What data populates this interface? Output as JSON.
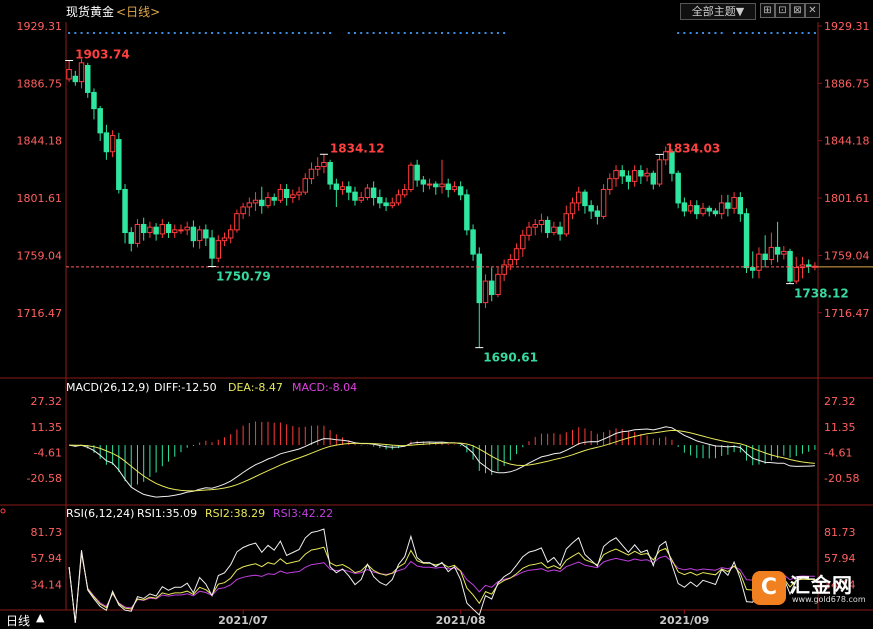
{
  "header": {
    "instrument": "现货黄金",
    "period_tag": "<日线>",
    "theme_button": "全部主题▼",
    "icons": [
      "grid-icon",
      "zoom-in-icon",
      "zoom-out-icon",
      "close-icon"
    ],
    "icon_glyphs": [
      "⊞",
      "⊡",
      "⊠",
      "✕"
    ]
  },
  "footer": {
    "timeframe": "日线",
    "timeframe_arrow": "▲"
  },
  "watermark": {
    "text": "汇金网",
    "url": "www.gold678.com",
    "mark": "C"
  },
  "chart_data": {
    "type": "candlestick",
    "colors": {
      "up": "#ff3b3b",
      "down": "#2ee6a0",
      "diff": "#f0f0f0",
      "dea": "#e8e85a",
      "macd": "#e040e0",
      "rsi1": "#f0f0f0",
      "rsi2": "#e8e85a",
      "rsi3": "#c040e0",
      "axis_label": "#ff6060",
      "dots": "#3a8ee6",
      "last_price_line": "#ff6060"
    },
    "main": {
      "y_ticks": [
        "1929.31",
        "1886.75",
        "1844.18",
        "1801.61",
        "1759.04",
        "1716.47"
      ],
      "ylim": [
        1674,
        1929.31
      ],
      "last_price": 1750.5,
      "annotations": [
        {
          "index": 0,
          "label": "1903.74",
          "type": "high"
        },
        {
          "index": 23,
          "label": "1750.79",
          "type": "low"
        },
        {
          "index": 41,
          "label": "1834.12",
          "type": "high"
        },
        {
          "index": 66,
          "label": "1690.61",
          "type": "low"
        },
        {
          "index": 95,
          "label": "1834.03",
          "type": "high"
        },
        {
          "index": 116,
          "label": "1738.12",
          "type": "low"
        }
      ],
      "candles": [
        [
          1890,
          1897,
          1888,
          1903.7
        ],
        [
          1892,
          1888,
          1885,
          1896
        ],
        [
          1888,
          1902,
          1883,
          1905
        ],
        [
          1900,
          1880,
          1876,
          1902
        ],
        [
          1880,
          1868,
          1860,
          1883
        ],
        [
          1868,
          1850,
          1844,
          1870
        ],
        [
          1850,
          1836,
          1830,
          1856
        ],
        [
          1836,
          1848,
          1832,
          1852
        ],
        [
          1845,
          1808,
          1805,
          1850
        ],
        [
          1808,
          1776,
          1768,
          1812
        ],
        [
          1776,
          1768,
          1762,
          1780
        ],
        [
          1768,
          1782,
          1765,
          1786
        ],
        [
          1782,
          1776,
          1770,
          1787
        ],
        [
          1776,
          1780,
          1772,
          1784
        ],
        [
          1780,
          1775,
          1770,
          1783
        ],
        [
          1775,
          1782,
          1772,
          1786
        ],
        [
          1782,
          1776,
          1772,
          1784
        ],
        [
          1776,
          1778,
          1772,
          1782
        ],
        [
          1778,
          1778,
          1775,
          1782
        ],
        [
          1778,
          1780,
          1774,
          1784
        ],
        [
          1780,
          1770,
          1765,
          1785
        ],
        [
          1770,
          1778,
          1764,
          1781
        ],
        [
          1778,
          1772,
          1766,
          1782
        ],
        [
          1772,
          1757,
          1750.8,
          1778
        ],
        [
          1757,
          1770,
          1754,
          1774
        ],
        [
          1770,
          1772,
          1766,
          1776
        ],
        [
          1772,
          1778,
          1768,
          1782
        ],
        [
          1778,
          1790,
          1776,
          1793
        ],
        [
          1790,
          1795,
          1786,
          1798
        ],
        [
          1795,
          1798,
          1788,
          1802
        ],
        [
          1798,
          1800,
          1792,
          1806
        ],
        [
          1800,
          1796,
          1790,
          1810
        ],
        [
          1796,
          1802,
          1794,
          1806
        ],
        [
          1802,
          1800,
          1796,
          1805
        ],
        [
          1800,
          1808,
          1798,
          1812
        ],
        [
          1808,
          1802,
          1796,
          1812
        ],
        [
          1802,
          1804,
          1798,
          1808
        ],
        [
          1804,
          1806,
          1800,
          1810
        ],
        [
          1806,
          1816,
          1804,
          1820
        ],
        [
          1816,
          1823,
          1812,
          1828
        ],
        [
          1823,
          1825,
          1818,
          1832
        ],
        [
          1825,
          1828,
          1820,
          1834.1
        ],
        [
          1828,
          1812,
          1808,
          1830
        ],
        [
          1812,
          1808,
          1795,
          1816
        ],
        [
          1808,
          1810,
          1804,
          1814
        ],
        [
          1810,
          1806,
          1800,
          1814
        ],
        [
          1806,
          1800,
          1796,
          1810
        ],
        [
          1800,
          1802,
          1798,
          1806
        ],
        [
          1802,
          1809,
          1800,
          1812
        ],
        [
          1809,
          1802,
          1796,
          1814
        ],
        [
          1802,
          1798,
          1794,
          1808
        ],
        [
          1798,
          1796,
          1792,
          1802
        ],
        [
          1796,
          1798,
          1794,
          1802
        ],
        [
          1798,
          1804,
          1796,
          1808
        ],
        [
          1804,
          1808,
          1802,
          1812
        ],
        [
          1808,
          1826,
          1806,
          1828
        ],
        [
          1826,
          1815,
          1810,
          1830
        ],
        [
          1815,
          1812,
          1806,
          1818
        ],
        [
          1812,
          1812,
          1808,
          1816
        ],
        [
          1812,
          1810,
          1804,
          1814
        ],
        [
          1810,
          1812,
          1805,
          1830
        ],
        [
          1812,
          1808,
          1802,
          1816
        ],
        [
          1808,
          1810,
          1806,
          1814
        ],
        [
          1810,
          1804,
          1800,
          1814
        ],
        [
          1804,
          1778,
          1774,
          1808
        ],
        [
          1778,
          1760,
          1755,
          1782
        ],
        [
          1760,
          1724,
          1690.6,
          1765
        ],
        [
          1724,
          1740,
          1720,
          1745
        ],
        [
          1740,
          1730,
          1725,
          1750
        ],
        [
          1730,
          1745,
          1728,
          1750
        ],
        [
          1745,
          1752,
          1740,
          1756
        ],
        [
          1752,
          1756,
          1748,
          1760
        ],
        [
          1756,
          1764,
          1752,
          1768
        ],
        [
          1764,
          1774,
          1758,
          1778
        ],
        [
          1774,
          1780,
          1770,
          1784
        ],
        [
          1780,
          1782,
          1774,
          1786
        ],
        [
          1782,
          1785,
          1776,
          1790
        ],
        [
          1785,
          1776,
          1772,
          1788
        ],
        [
          1776,
          1780,
          1774,
          1784
        ],
        [
          1780,
          1775,
          1770,
          1784
        ],
        [
          1775,
          1790,
          1773,
          1796
        ],
        [
          1790,
          1798,
          1786,
          1802
        ],
        [
          1798,
          1806,
          1792,
          1810
        ],
        [
          1806,
          1796,
          1790,
          1808
        ],
        [
          1796,
          1792,
          1786,
          1800
        ],
        [
          1792,
          1788,
          1782,
          1796
        ],
        [
          1788,
          1808,
          1786,
          1812
        ],
        [
          1808,
          1816,
          1804,
          1820
        ],
        [
          1816,
          1822,
          1810,
          1826
        ],
        [
          1822,
          1818,
          1812,
          1826
        ],
        [
          1818,
          1814,
          1808,
          1822
        ],
        [
          1814,
          1822,
          1810,
          1826
        ],
        [
          1822,
          1818,
          1812,
          1826
        ],
        [
          1818,
          1820,
          1814,
          1824
        ],
        [
          1820,
          1812,
          1808,
          1822
        ],
        [
          1812,
          1830,
          1810,
          1834
        ],
        [
          1830,
          1836,
          1826,
          1840
        ],
        [
          1836,
          1820,
          1814,
          1838
        ],
        [
          1820,
          1798,
          1794,
          1822
        ],
        [
          1798,
          1792,
          1788,
          1802
        ],
        [
          1792,
          1796,
          1790,
          1800
        ],
        [
          1796,
          1790,
          1786,
          1800
        ],
        [
          1790,
          1794,
          1788,
          1798
        ],
        [
          1794,
          1792,
          1788,
          1796
        ],
        [
          1792,
          1790,
          1788,
          1794
        ],
        [
          1790,
          1798,
          1786,
          1804
        ],
        [
          1798,
          1794,
          1788,
          1804
        ],
        [
          1794,
          1802,
          1790,
          1806
        ],
        [
          1802,
          1790,
          1784,
          1806
        ],
        [
          1790,
          1750,
          1746,
          1794
        ],
        [
          1750,
          1748,
          1742,
          1762
        ],
        [
          1748,
          1760,
          1742,
          1765
        ],
        [
          1760,
          1756,
          1750,
          1774
        ],
        [
          1756,
          1765,
          1752,
          1776
        ],
        [
          1765,
          1760,
          1754,
          1784
        ],
        [
          1760,
          1762,
          1756,
          1766
        ],
        [
          1762,
          1740,
          1738.1,
          1764
        ],
        [
          1740,
          1750,
          1738,
          1758
        ],
        [
          1750,
          1752,
          1742,
          1758
        ],
        [
          1752,
          1751,
          1746,
          1756
        ],
        [
          1751,
          1751,
          1748,
          1754
        ]
      ]
    },
    "macd": {
      "label": "MACD(26,12,9)",
      "diff_label": "DIFF:-12.50",
      "dea_label": "DEA:-8.47",
      "macd_label": "MACD:-8.04",
      "y_ticks": [
        "27.32",
        "11.35",
        "-4.61",
        "-20.58"
      ],
      "ylim": [
        -36,
        33
      ]
    },
    "rsi": {
      "label": "RSI(6,12,24)",
      "rsi1_label": "RSI1:35.09",
      "rsi2_label": "RSI2:38.29",
      "rsi3_label": "RSI3:42.22",
      "y_ticks": [
        "81.73",
        "57.94",
        "34.14"
      ],
      "ylim": [
        15,
        95
      ]
    },
    "x_ticks": [
      {
        "index": 28,
        "label": "2021/07"
      },
      {
        "index": 63,
        "label": "2021/08"
      },
      {
        "index": 99,
        "label": "2021/09"
      }
    ]
  }
}
